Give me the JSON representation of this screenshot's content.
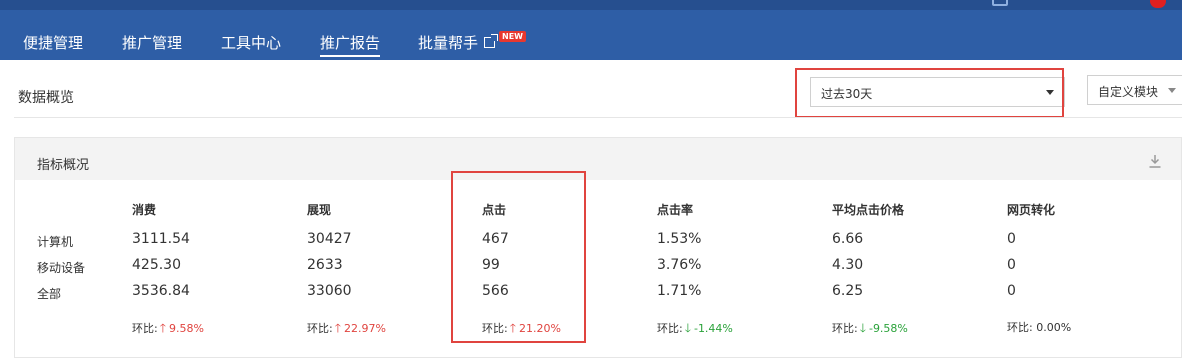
{
  "header": {
    "nav": [
      {
        "label": "便捷管理",
        "active": false
      },
      {
        "label": "推广管理",
        "active": false
      },
      {
        "label": "工具中心",
        "active": false
      },
      {
        "label": "推广报告",
        "active": true
      },
      {
        "label": "批量帮手",
        "active": false
      }
    ],
    "new_badge": "NEW"
  },
  "overview": {
    "title": "数据概览",
    "range_value": "过去30天",
    "custom_label": "自定义模块"
  },
  "panel": {
    "title": "指标概况",
    "columns": [
      "消费",
      "展现",
      "点击",
      "点击率",
      "平均点击价格",
      "网页转化"
    ],
    "rows": [
      {
        "label": "计算机",
        "values": [
          "3111.54",
          "30427",
          "467",
          "1.53%",
          "6.66",
          "0"
        ]
      },
      {
        "label": "移动设备",
        "values": [
          "425.30",
          "2633",
          "99",
          "3.76%",
          "4.30",
          "0"
        ]
      },
      {
        "label": "全部",
        "values": [
          "3536.84",
          "33060",
          "566",
          "1.71%",
          "6.25",
          "0"
        ]
      }
    ],
    "ratio_prefix": "环比:",
    "ratios": [
      {
        "value": "9.58%",
        "trend": "up"
      },
      {
        "value": "22.97%",
        "trend": "up"
      },
      {
        "value": "21.20%",
        "trend": "up"
      },
      {
        "value": "-1.44%",
        "trend": "down"
      },
      {
        "value": "-9.58%",
        "trend": "down"
      },
      {
        "value": "0.00%",
        "trend": "none"
      }
    ]
  },
  "colors": {
    "header_bg": "#2e5ea6",
    "highlight": "#e0443f",
    "up": "#e0443f",
    "down": "#2aa23a"
  }
}
